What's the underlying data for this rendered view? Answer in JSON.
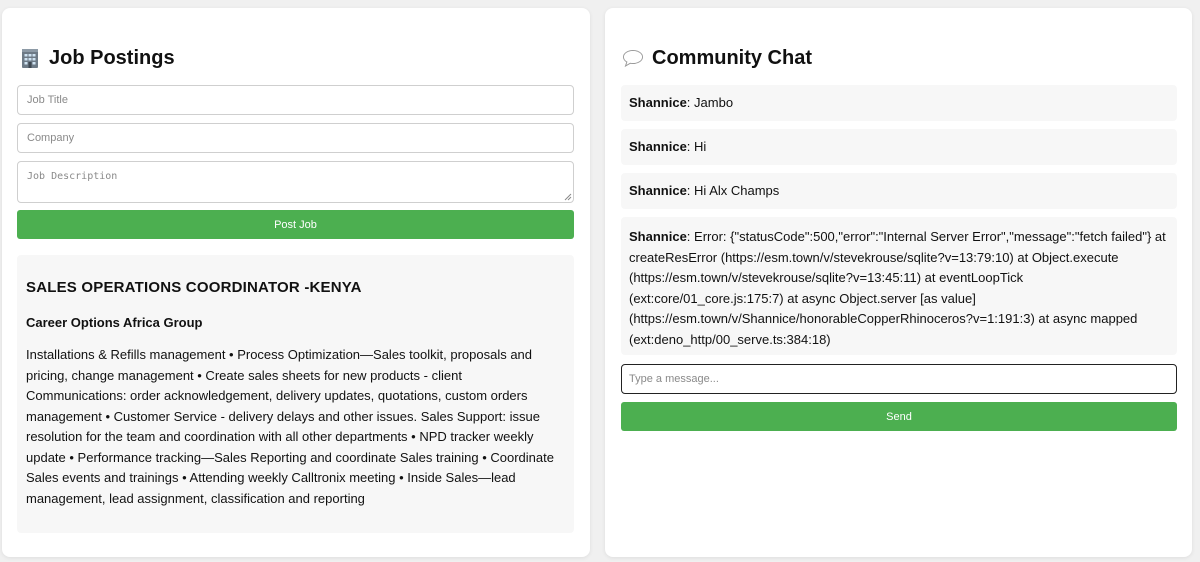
{
  "colors": {
    "accent": "#4caf50",
    "panel_bg": "#ffffff",
    "card_bg": "#f7f7f7",
    "page_bg": "#f0f0f0"
  },
  "jobs": {
    "title": "Job Postings",
    "icon": "office-building-icon",
    "form": {
      "job_title_placeholder": "Job Title",
      "company_placeholder": "Company",
      "description_placeholder": "Job Description",
      "post_label": "Post Job"
    },
    "postings": [
      {
        "title": "SALES OPERATIONS COORDINATOR -KENYA",
        "company": "Career Options Africa Group",
        "description": "Installations & Refills management • Process Optimization—Sales toolkit, proposals and pricing, change management • Create sales sheets for new products - client Communications: order acknowledgement, delivery updates, quotations, custom orders management • Customer Service - delivery delays and other issues. Sales Support: issue resolution for the team and coordination with all other departments • NPD tracker weekly update • Performance tracking—Sales Reporting and coordinate Sales training • Coordinate Sales events and trainings • Attending weekly Calltronix meeting • Inside Sales—lead management, lead assignment, classification and reporting"
      }
    ]
  },
  "chat": {
    "title": "Community Chat",
    "icon": "speech-bubble-icon",
    "messages": [
      {
        "user": "Shannice",
        "text": "Jambo"
      },
      {
        "user": "Shannice",
        "text": "Hi"
      },
      {
        "user": "Shannice",
        "text": "Hi Alx Champs"
      },
      {
        "user": "Shannice",
        "text": "Error: {\"statusCode\":500,\"error\":\"Internal Server Error\",\"message\":\"fetch failed\"} at createResError (https://esm.town/v/stevekrouse/sqlite?v=13:79:10) at Object.execute (https://esm.town/v/stevekrouse/sqlite?v=13:45:11) at eventLoopTick (ext:core/01_core.js:175:7) at async Object.server [as value] (https://esm.town/v/Shannice/honorableCopperRhinoceros?v=1:191:3) at async mapped (ext:deno_http/00_serve.ts:384:18)"
      }
    ],
    "input_placeholder": "Type a message...",
    "send_label": "Send"
  }
}
